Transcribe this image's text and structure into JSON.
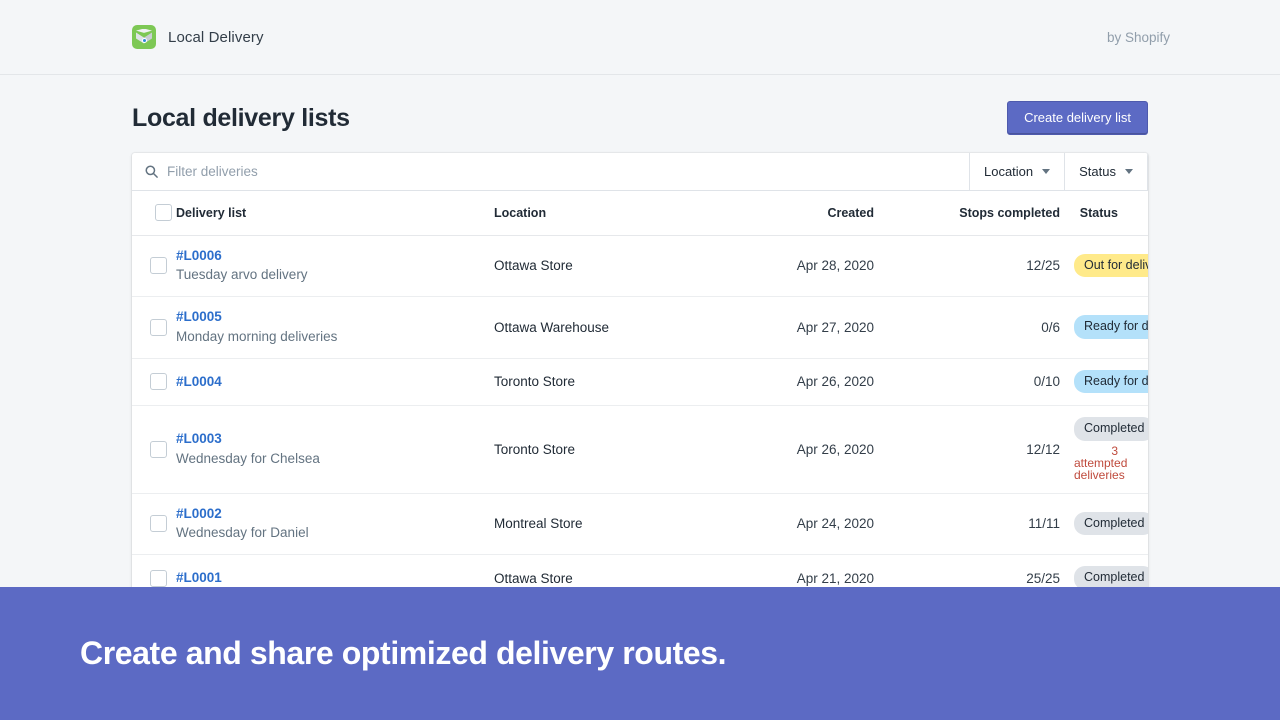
{
  "header": {
    "app_name": "Local Delivery",
    "byline": "by Shopify",
    "icon": "package-icon"
  },
  "page": {
    "title": "Local delivery lists",
    "create_button": "Create delivery list"
  },
  "filters": {
    "search_placeholder": "Filter deliveries",
    "search_value": "",
    "search_icon": "search-icon",
    "location_label": "Location",
    "status_label": "Status"
  },
  "table": {
    "columns": [
      "Delivery list",
      "Location",
      "Created",
      "Stops completed",
      "Status"
    ],
    "rows": [
      {
        "id": "#L0006",
        "subtitle": "Tuesday arvo delivery",
        "location": "Ottawa Store",
        "created": "Apr 28, 2020",
        "stops": "12/25",
        "status": "Out for delivery",
        "status_tone": "yellow",
        "note": ""
      },
      {
        "id": "#L0005",
        "subtitle": "Monday morning deliveries",
        "location": "Ottawa Warehouse",
        "created": "Apr 27, 2020",
        "stops": "0/6",
        "status": "Ready for dispatch",
        "status_tone": "blue",
        "note": ""
      },
      {
        "id": "#L0004",
        "subtitle": "",
        "location": "Toronto Store",
        "created": "Apr 26, 2020",
        "stops": "0/10",
        "status": "Ready for dispatch",
        "status_tone": "blue",
        "note": ""
      },
      {
        "id": "#L0003",
        "subtitle": "Wednesday for Chelsea",
        "location": "Toronto Store",
        "created": "Apr 26, 2020",
        "stops": "12/12",
        "status": "Completed",
        "status_tone": "neutral",
        "note": "3 attempted deliveries"
      },
      {
        "id": "#L0002",
        "subtitle": "Wednesday for Daniel",
        "location": "Montreal Store",
        "created": "Apr 24, 2020",
        "stops": "11/11",
        "status": "Completed",
        "status_tone": "neutral",
        "note": ""
      },
      {
        "id": "#L0001",
        "subtitle": "",
        "location": "Ottawa Store",
        "created": "Apr 21, 2020",
        "stops": "25/25",
        "status": "Completed",
        "status_tone": "neutral",
        "note": ""
      }
    ]
  },
  "banner": {
    "headline": "Create and share optimized delivery routes."
  },
  "colors": {
    "accent": "#5c6ac4",
    "link": "#2c6ecb",
    "badge_yellow": "#ffea8a",
    "badge_blue": "#b4e1fa",
    "badge_neutral": "#dfe3e8",
    "note_red": "#bf4a3c",
    "brand_green": "#7dc855",
    "page_bg": "#f4f6f8"
  }
}
